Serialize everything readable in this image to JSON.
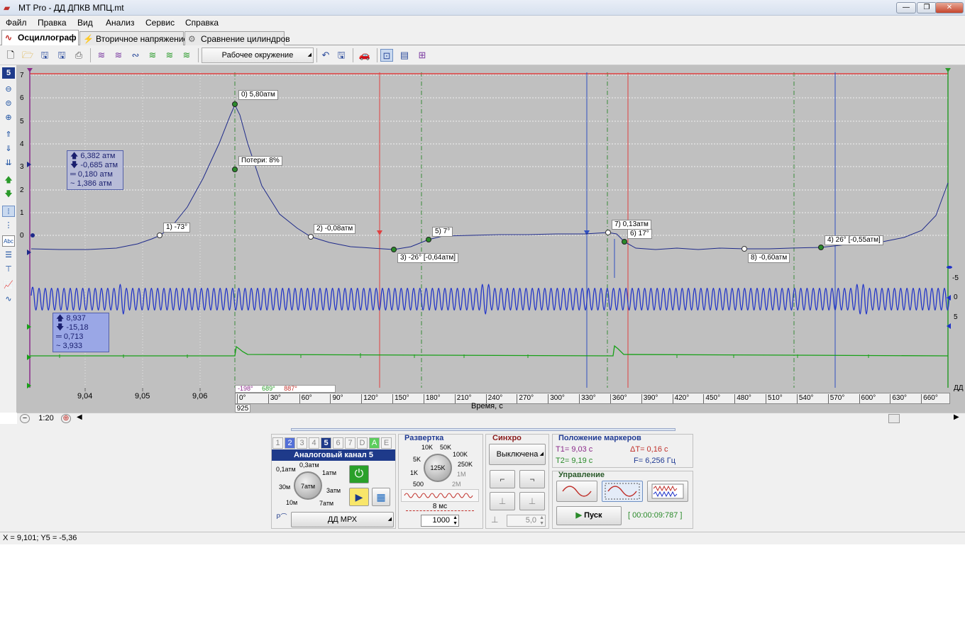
{
  "window": {
    "title": "MT Pro - ДД ДПКВ МПЦ.mt"
  },
  "menu": [
    "Файл",
    "Правка",
    "Вид",
    "Анализ",
    "Сервис",
    "Справка"
  ],
  "tabs": [
    "Осциллограф",
    "Вторичное напряжение",
    "Сравнение цилиндров"
  ],
  "toolbar": {
    "environment": "Рабочее окружение"
  },
  "left_tools": {
    "channel_number": "5",
    "text_tool": "Abc"
  },
  "plot": {
    "y_labels": [
      "7",
      "6",
      "5",
      "4",
      "3",
      "2",
      "1",
      "0"
    ],
    "right_labels": [
      "-5",
      "0",
      "5"
    ],
    "stats_pressure": [
      "6,382 атм",
      "-0,685 атм",
      "0,180 атм",
      "1,386 атм"
    ],
    "stats_signal": [
      "8,937",
      "-15,18",
      "0,713",
      "3,933"
    ],
    "markers": {
      "m0": "0)  5,80атм",
      "loss": "Потери: 8%",
      "m1": "1)  -73°",
      "m2": "2)  -0,08атм",
      "m3": "3)  -26° [-0,64атм]",
      "m5": "5)  7°",
      "m7": "7)  0,13атм",
      "m6": "6)  17°",
      "m4": "4)  26° [-0,55атм]",
      "m8": "8)  -0,60атм"
    },
    "time_labels": [
      "9,04",
      "9,05",
      "9,06"
    ],
    "angle_labels": [
      "0°",
      "30°",
      "60°",
      "90°",
      "120°",
      "150°",
      "180°",
      "210°",
      "240°",
      "270°",
      "300°",
      "330°",
      "360°",
      "390°",
      "420°",
      "450°",
      "480°",
      "510°",
      "540°",
      "570°",
      "600°",
      "630°",
      "660°"
    ],
    "angle_strip": [
      "-198°",
      "689°",
      "887°"
    ],
    "rpm": "925",
    "x_axis_title": "Время, с",
    "corner": "ДД"
  },
  "zoom": "1:20",
  "channels": {
    "tabs": [
      "1",
      "2",
      "3",
      "4",
      "5",
      "6",
      "7",
      "D",
      "A",
      "E"
    ],
    "header": "Аналоговый канал 5",
    "range_labels": [
      "0,1атм",
      "0,3атм",
      "1атм",
      "3атм",
      "7атм",
      "10м",
      "30м"
    ],
    "knob_value": "7атм",
    "sensor": "ДД МРХ"
  },
  "sweep": {
    "title": "Развертка",
    "labels": [
      "10K",
      "50K",
      "5K",
      "100K",
      "250K",
      "1K",
      "1M",
      "500",
      "2M"
    ],
    "knob_value": "125K",
    "time_per_div": "8 мс",
    "points": "1000"
  },
  "sync": {
    "title": "Синхро",
    "mode": "Выключена",
    "level": "5,0"
  },
  "marker_position": {
    "title": "Положение маркеров",
    "t1": "T1= 9,03 с",
    "dt": "ΔT= 0,16 с",
    "t2": "T2= 9,19 с",
    "f": "F= 6,256 Гц"
  },
  "control": {
    "title": "Управление",
    "start": "Пуск",
    "timer": "[ 00:00:09:787 ]"
  },
  "status": {
    "coords": "X = 9,101; Y5 = -5,36"
  }
}
